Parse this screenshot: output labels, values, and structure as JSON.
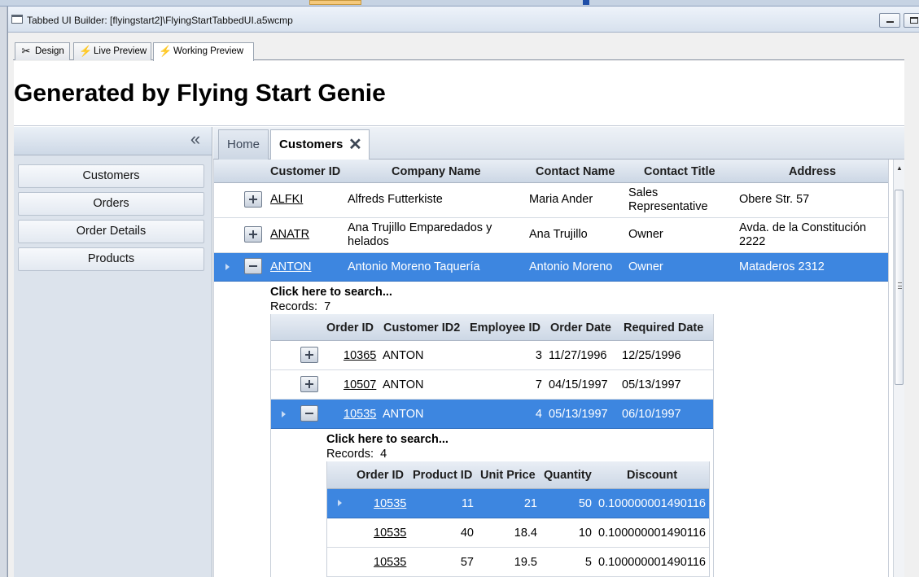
{
  "window": {
    "title": "Tabbed UI Builder: [flyingstart2]\\FlyingStartTabbedUI.a5wcmp"
  },
  "mode_tabs": [
    {
      "label": "Design",
      "icon": "design-tools-icon"
    },
    {
      "label": "Live Preview",
      "icon": "lightning-icon"
    },
    {
      "label": "Working Preview",
      "icon": "lightning-icon"
    }
  ],
  "page": {
    "title": "Generated by Flying Start Genie"
  },
  "sidebar": {
    "collapse_glyph": "«",
    "items": [
      {
        "label": "Customers"
      },
      {
        "label": "Orders"
      },
      {
        "label": "Order Details"
      },
      {
        "label": "Products"
      }
    ]
  },
  "doc_tabs": {
    "home": "Home",
    "customers": "Customers",
    "close_glyph": "✕"
  },
  "customers_grid": {
    "columns": [
      "Customer ID",
      "Company Name",
      "Contact Name",
      "Contact Title",
      "Address"
    ],
    "rows": [
      {
        "id": "ALFKI",
        "company": "Alfreds Futterkiste",
        "company2": "",
        "contact": "Maria Ander",
        "title": "Sales",
        "title2": "Representative",
        "address": "Obere Str. 57",
        "address2": ""
      },
      {
        "id": "ANATR",
        "company": "Ana Trujillo Emparedados y",
        "company2": "helados",
        "contact": "Ana Trujillo",
        "title": "Owner",
        "title2": "",
        "address": "Avda. de la Constitución",
        "address2": "2222"
      },
      {
        "id": "ANTON",
        "company": "Antonio Moreno Taquería",
        "company2": "",
        "contact": "Antonio Moreno",
        "title": "Owner",
        "title2": "",
        "address": "Mataderos 2312",
        "address2": ""
      }
    ]
  },
  "orders_grid": {
    "search_label": "Click here to search...",
    "records_label": "Records:",
    "records_count": "7",
    "columns": [
      "Order ID",
      "Customer ID2",
      "Employee ID",
      "Order Date",
      "Required Date"
    ],
    "rows": [
      {
        "order_id": "10365",
        "customer": "ANTON",
        "employee": "3",
        "order_date": "11/27/1996",
        "required": "12/25/1996"
      },
      {
        "order_id": "10507",
        "customer": "ANTON",
        "employee": "7",
        "order_date": "04/15/1997",
        "required": "05/13/1997"
      },
      {
        "order_id": "10535",
        "customer": "ANTON",
        "employee": "4",
        "order_date": "05/13/1997",
        "required": "06/10/1997"
      }
    ]
  },
  "details_grid": {
    "search_label": "Click here to search...",
    "records_label": "Records:",
    "records_count": "4",
    "columns": [
      "Order ID",
      "Product ID",
      "Unit Price",
      "Quantity",
      "Discount"
    ],
    "rows": [
      {
        "order_id": "10535",
        "product": "11",
        "price": "21",
        "qty": "50",
        "discount": "0.100000001490116"
      },
      {
        "order_id": "10535",
        "product": "40",
        "price": "18.4",
        "qty": "10",
        "discount": "0.100000001490116"
      },
      {
        "order_id": "10535",
        "product": "57",
        "price": "19.5",
        "qty": "5",
        "discount": "0.100000001490116"
      }
    ]
  }
}
